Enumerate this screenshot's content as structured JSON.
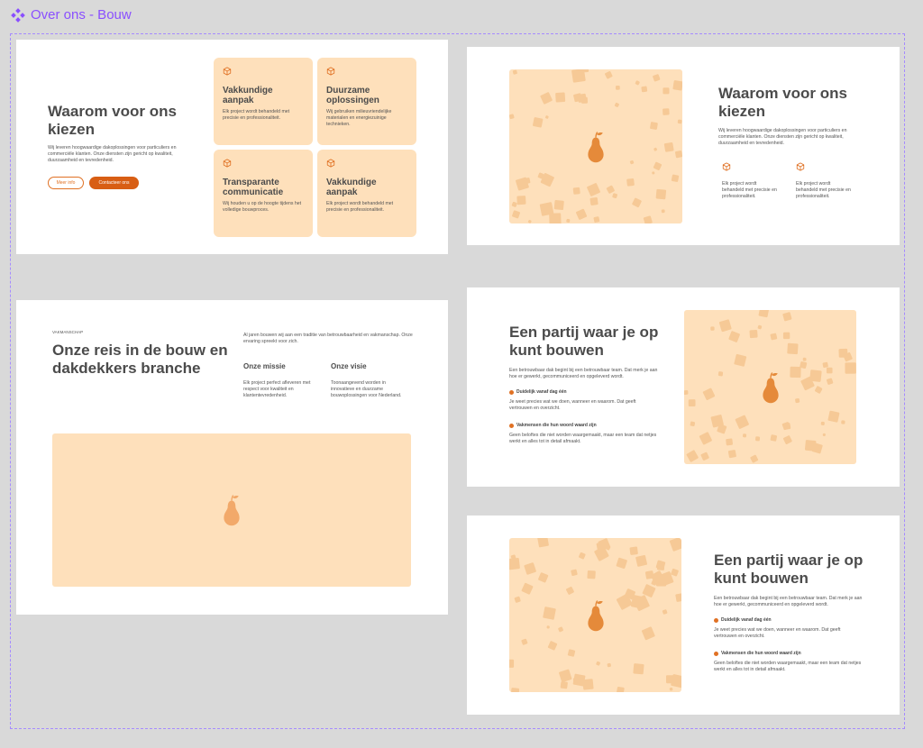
{
  "canvas": {
    "title": "Over ons - Bouw",
    "accent": "#8a4fff"
  },
  "colors": {
    "peach": "#fee0bb",
    "orange": "#e07124",
    "pear": "#e58a3a"
  },
  "card1": {
    "title": "Waarom voor ons kiezen",
    "description": "Wij leveren hoogwaardige dakoplossingen voor particuliers en commerciële klanten. Onze diensten zijn gericht op kwaliteit, duurzaamheid en tevredenheid.",
    "btn_more": "Meer info",
    "btn_contact": "Contacteer ons",
    "tiles": [
      {
        "title": "Vakkundige aanpak",
        "text": "Elk project wordt behandeld met precisie en professionaliteit."
      },
      {
        "title": "Duurzame oplossingen",
        "text": "Wij gebruiken milieuvriendelijke materialen en energiezuinige technieken."
      },
      {
        "title": "Transparante communicatie",
        "text": "Wij houden u op de hoogte tijdens het volledige bouwproces."
      },
      {
        "title": "Vakkundige aanpak",
        "text": "Elk project wordt behandeld met precisie en professionaliteit."
      }
    ]
  },
  "card2": {
    "title": "Waarom voor ons kiezen",
    "description": "Wij leveren hoogwaardige dakoplossingen voor particuliers en commerciële klanten. Onze diensten zijn gericht op kwaliteit, duurzaamheid en tevredenheid.",
    "features": [
      {
        "text": "Elk project wordt behandeld met precisie en professionaliteit."
      },
      {
        "text": "Elk project wordt behandeld met precisie en professionaliteit."
      }
    ]
  },
  "card3": {
    "eyebrow": "VAKMANSCHAP",
    "title": "Onze reis in de bouw en dakdekkers branche",
    "intro": "Al jaren bouwen wij aan een traditie van betrouwbaarheid en vakmanschap. Onze ervaring spreekt voor zich.",
    "mission_title": "Onze missie",
    "mission_text": "Elk project perfect afleveren met respect voor kwaliteit en klantentevredenheid.",
    "vision_title": "Onze visie",
    "vision_text": "Toonaangevend worden in innovatieve en duurzame bouwoplossingen voor Nederland."
  },
  "card4": {
    "title": "Een partij waar je op kunt bouwen",
    "description": "Een betrouwbaar dak begint bij een betrouwbaar team. Dat merk je aan hoe er gewerkt, gecommuniceerd en opgeleverd wordt.",
    "f1_title": "Duidelijk vanaf dag één",
    "f1_text": "Je weet precies wat we doen, wanneer en waarom. Dat geeft vertrouwen en overzicht.",
    "f2_title": "Vakmensen die hun woord waard zijn",
    "f2_text": "Geen beloftes die niet worden waargemaakt, maar een team dat netjes werkt en alles tot in detail afmaakt."
  },
  "card5": {
    "title": "Een partij waar je op kunt bouwen",
    "description": "Een betrouwbaar dak begint bij een betrouwbaar team. Dat merk je aan hoe er gewerkt, gecommuniceerd en opgeleverd wordt.",
    "f1_title": "Duidelijk vanaf dag één",
    "f1_text": "Je weet precies wat we doen, wanneer en waarom. Dat geeft vertrouwen en overzicht.",
    "f2_title": "Vakmensen die hun woord waard zijn",
    "f2_text": "Geen beloftes die niet worden waargemaakt, maar een team dat netjes werkt en alles tot in detail afmaakt."
  }
}
